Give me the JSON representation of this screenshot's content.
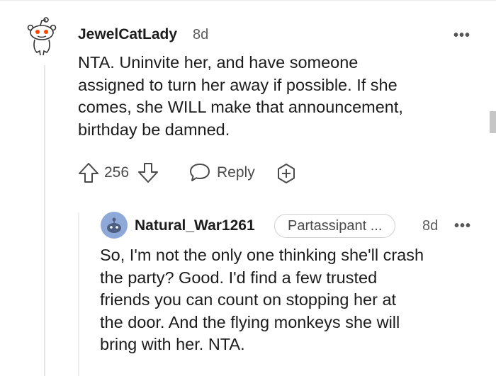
{
  "comment": {
    "username": "JewelCatLady",
    "age": "8d",
    "body_lines": [
      "NTA. Uninvite her, and have someone",
      "assigned to turn her away if possible. If she",
      "comes, she WILL make that announcement,",
      "birthday be damned."
    ],
    "score": "256",
    "reply_label": "Reply",
    "more_label": "•••",
    "avatar_icon": "snoo-avatar-icon",
    "accent_color": "#ff4500"
  },
  "reply": {
    "username": "Natural_War1261",
    "flair": "Partassipant ...",
    "age": "8d",
    "more_label": "•••",
    "body_lines": [
      "So, I'm not the only one thinking she'll crash",
      "the party? Good. I'd find a few trusted",
      "friends you can count on stopping her at",
      "the door. And the flying monkeys she will",
      "bring with her. NTA."
    ],
    "avatar_icon": "snoo-avatar-blue-icon",
    "avatar_color": "#8ea9d8"
  }
}
